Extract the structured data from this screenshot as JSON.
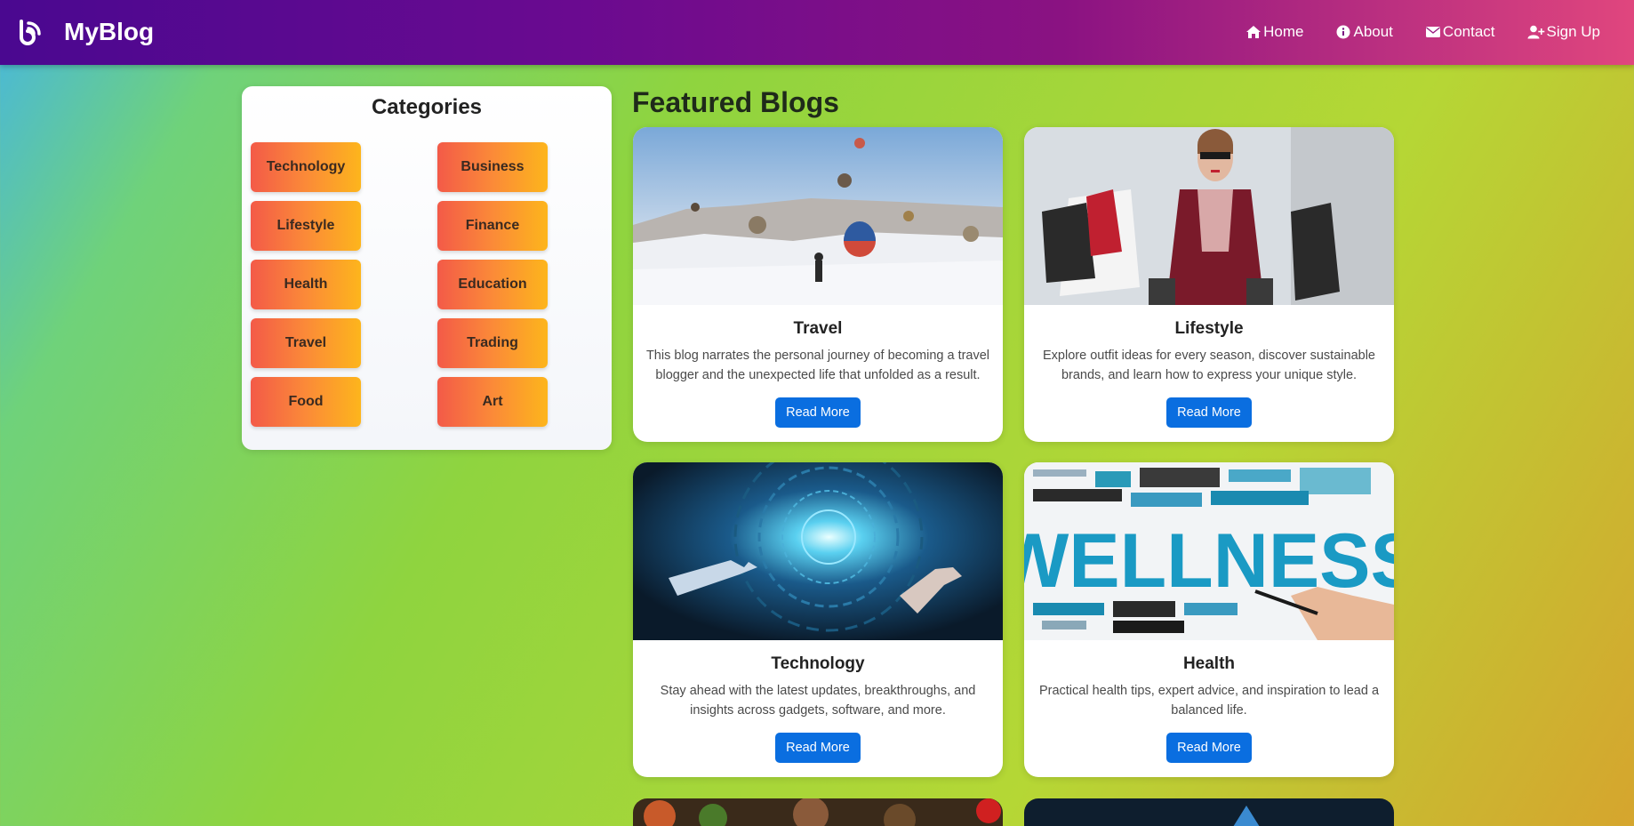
{
  "nav": {
    "brand": "MyBlog",
    "links": [
      {
        "label": "Home",
        "icon": "home-icon"
      },
      {
        "label": "About",
        "icon": "info-icon"
      },
      {
        "label": "Contact",
        "icon": "mail-icon"
      },
      {
        "label": "Sign Up",
        "icon": "user-plus-icon"
      }
    ]
  },
  "sidebar": {
    "title": "Categories",
    "categories": [
      "Technology",
      "Business",
      "Lifestyle",
      "Finance",
      "Health",
      "Education",
      "Travel",
      "Trading",
      "Food",
      "Art"
    ]
  },
  "featured": {
    "title": "Featured Blogs",
    "cards": [
      {
        "title": "Travel",
        "description": "This blog narrates the personal journey of becoming a travel blogger and the unexpected life that unfolded as a result.",
        "button": "Read More"
      },
      {
        "title": "Lifestyle",
        "description": "Explore outfit ideas for every season, discover sustainable brands, and learn how to express your unique style.",
        "button": "Read More"
      },
      {
        "title": "Technology",
        "description": "Stay ahead with the latest updates, breakthroughs, and insights across gadgets, software, and more.",
        "button": "Read More"
      },
      {
        "title": "Health",
        "description": "Practical health tips, expert advice, and inspiration to lead a balanced life.",
        "button": "Read More"
      }
    ],
    "wellness_image_text": "WELLNESS"
  },
  "colors": {
    "nav_start": "#4a0890",
    "nav_end": "#e0467e",
    "category_gradient_start": "#f35a48",
    "category_gradient_end": "#fdb51c",
    "button": "#0a6ee0"
  }
}
